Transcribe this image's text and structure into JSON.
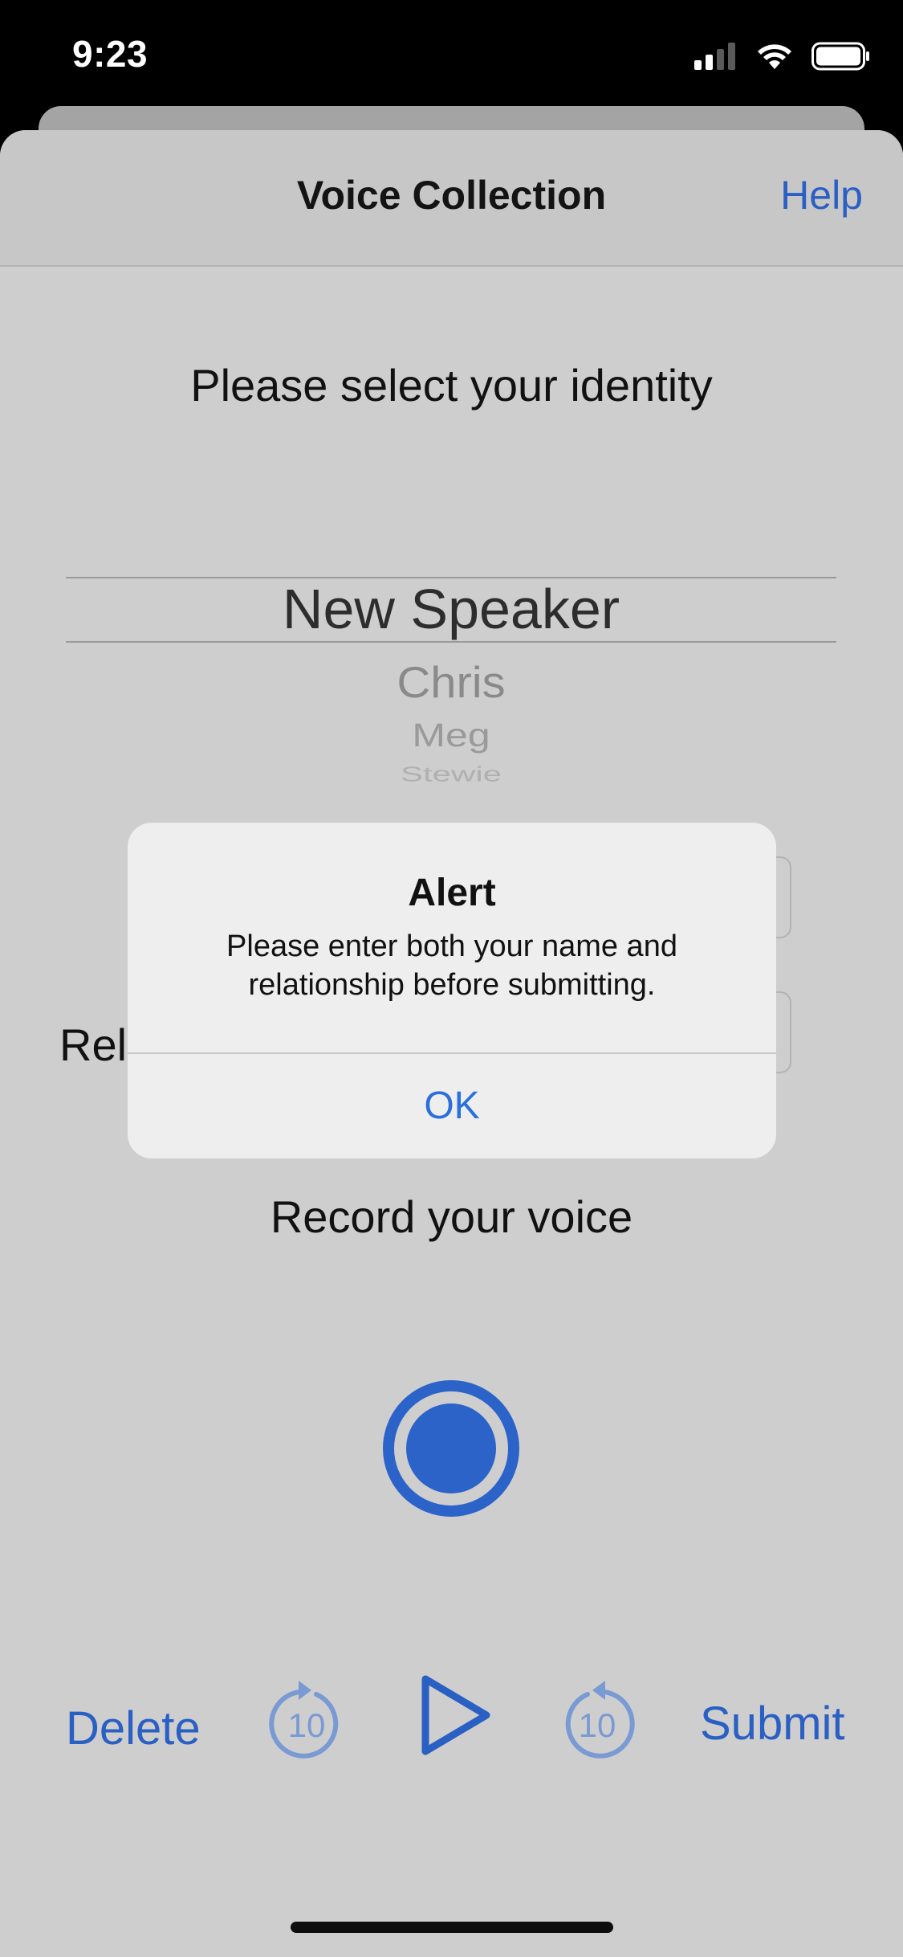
{
  "status_bar": {
    "time": "9:23"
  },
  "nav": {
    "title": "Voice Collection",
    "help_label": "Help"
  },
  "prompt": "Please select your identity",
  "picker": {
    "items": [
      "New Speaker",
      "Chris",
      "Meg",
      "Stewie"
    ],
    "selected": "New Speaker"
  },
  "form": {
    "relationship_label_partial": "Rel"
  },
  "record_label": "Record your voice",
  "controls": {
    "delete_label": "Delete",
    "skip_back_value": "10",
    "skip_forward_value": "10",
    "submit_label": "Submit"
  },
  "alert": {
    "title": "Alert",
    "message": "Please enter both your name and relationship before submitting.",
    "ok_label": "OK"
  },
  "colors": {
    "accent": "#2a5fc3",
    "record": "#2b63c9",
    "sheet_background": "#cecece",
    "alert_background": "#eeeeee"
  },
  "icons": {
    "record": "record-icon",
    "skip_back": "skip-back-10-icon",
    "play": "play-icon",
    "skip_forward": "skip-forward-10-icon"
  }
}
